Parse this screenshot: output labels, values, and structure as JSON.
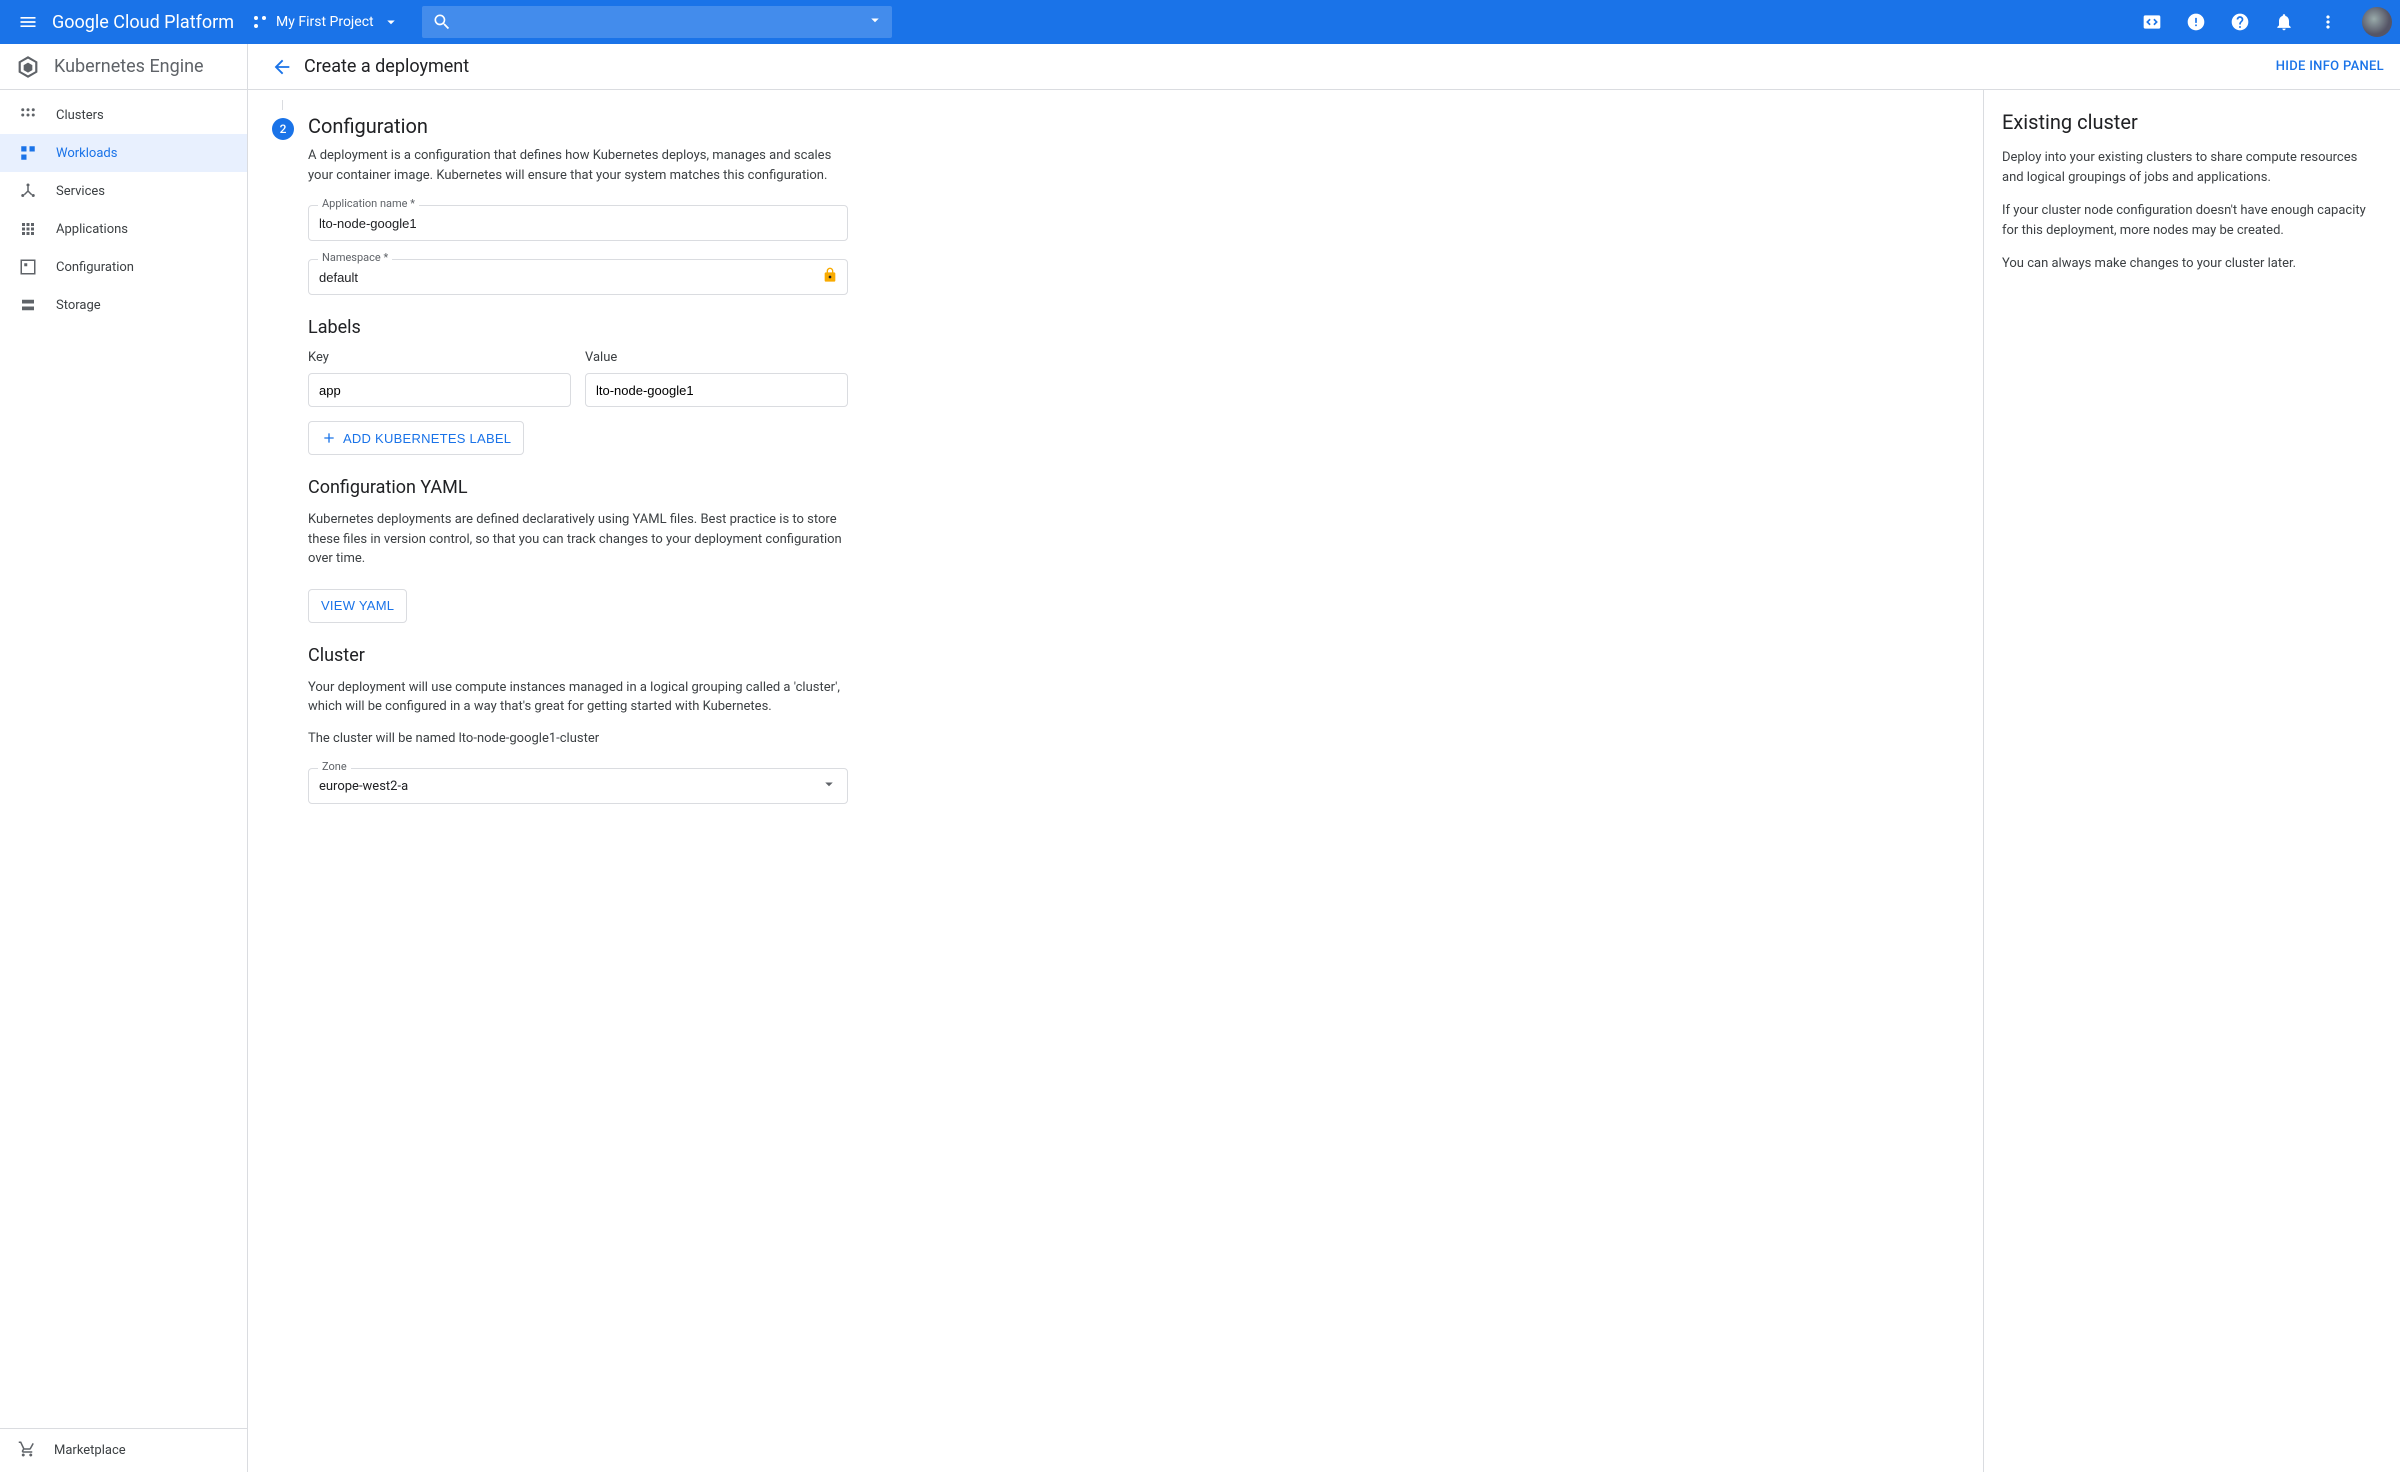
{
  "topbar": {
    "brand": "Google Cloud Platform",
    "project": "My First Project"
  },
  "product": {
    "name": "Kubernetes Engine",
    "page_title": "Create a deployment",
    "hide_panel": "HIDE INFO PANEL"
  },
  "sidebar": {
    "items": [
      {
        "label": "Clusters"
      },
      {
        "label": "Workloads"
      },
      {
        "label": "Services"
      },
      {
        "label": "Applications"
      },
      {
        "label": "Configuration"
      },
      {
        "label": "Storage"
      }
    ],
    "marketplace": "Marketplace"
  },
  "form": {
    "step_number": "2",
    "config_heading": "Configuration",
    "config_desc": "A deployment is a configuration that defines how Kubernetes deploys, manages and scales your container image. Kubernetes will ensure that your system matches this configuration.",
    "app_name_label": "Application name *",
    "app_name_value": "lto-node-google1",
    "namespace_label": "Namespace *",
    "namespace_value": "default",
    "labels_heading": "Labels",
    "labels_key_header": "Key",
    "labels_value_header": "Value",
    "label_key": "app",
    "label_value": "lto-node-google1",
    "add_label_btn": "ADD KUBERNETES LABEL",
    "yaml_heading": "Configuration YAML",
    "yaml_desc": "Kubernetes deployments are defined declaratively using YAML files. Best practice is to store these files in version control, so that you can track changes to your deployment configuration over time.",
    "view_yaml_btn": "VIEW YAML",
    "cluster_heading": "Cluster",
    "cluster_desc": "Your deployment will use compute instances managed in a logical grouping called a 'cluster', which will be configured in a way that's great for getting started with Kubernetes.",
    "cluster_name_line": "The cluster will be named lto-node-google1-cluster",
    "zone_label": "Zone",
    "zone_value": "europe-west2-a"
  },
  "info_panel": {
    "heading": "Existing cluster",
    "p1": "Deploy into your existing clusters to share compute resources and logical groupings of jobs and applications.",
    "p2": "If your cluster node configuration doesn't have enough capacity for this deployment, more nodes may be created.",
    "p3": "You can always make changes to your cluster later."
  }
}
